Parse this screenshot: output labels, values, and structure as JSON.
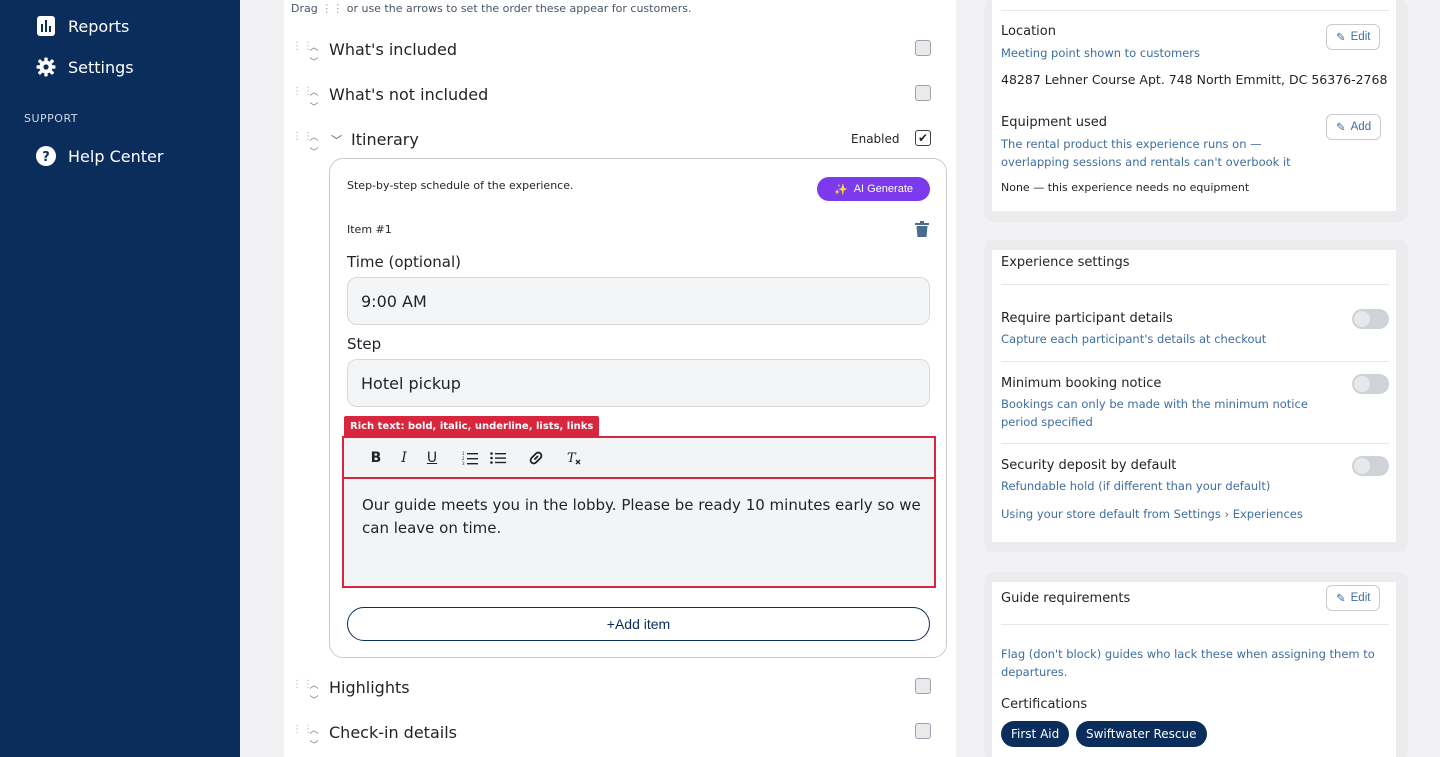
{
  "sidebar": {
    "items": [
      {
        "label": "Reports",
        "icon": "reports-icon"
      },
      {
        "label": "Settings",
        "icon": "gear-icon"
      }
    ],
    "support_heading": "SUPPORT",
    "help": {
      "label": "Help Center",
      "icon": "help-icon"
    }
  },
  "main": {
    "hint_prefix": "Drag",
    "hint_dots": "⋮⋮",
    "hint_suffix": "or use the arrows to set the order these appear for customers.",
    "sections": [
      {
        "title": "What's included",
        "checked": false
      },
      {
        "title": "What's not included",
        "checked": false
      },
      {
        "title": "Itinerary",
        "checked": true,
        "enabled_label": "Enabled"
      },
      {
        "title": "Highlights",
        "checked": false
      },
      {
        "title": "Check-in details",
        "checked": false
      }
    ],
    "itinerary": {
      "description": "Step-by-step schedule of the experience.",
      "ai_button": "AI Generate",
      "item_label": "Item #1",
      "time_label": "Time (optional)",
      "time_value": "9:00 AM",
      "step_label": "Step",
      "step_value": "Hotel pickup",
      "rich_text_tag": "Rich text: bold, italic, underline, lists, links",
      "toolbar": {
        "bold": "B",
        "italic": "I",
        "underline": "U"
      },
      "content": "Our guide meets you in the lobby. Please be ready 10 minutes early so we can leave on time.",
      "add_item": "+Add item"
    }
  },
  "right": {
    "location": {
      "title": "Location",
      "subtitle": "Meeting point shown to customers",
      "value": "48287 Lehner Course Apt. 748 North Emmitt, DC 56376-2768",
      "button": "Edit"
    },
    "equipment": {
      "title": "Equipment used",
      "subtitle": "The rental product this experience runs on — overlapping sessions and rentals can't overbook it",
      "value": "None — this experience needs no equipment",
      "button": "Add"
    },
    "experience_settings": {
      "title": "Experience settings",
      "rows": [
        {
          "title": "Require participant details",
          "subtitle": "Capture each participant's details at checkout",
          "on": false
        },
        {
          "title": "Minimum booking notice",
          "subtitle": "Bookings can only be made with the minimum notice period specified",
          "on": false
        },
        {
          "title": "Security deposit by default",
          "subtitle": "Refundable hold (if different than your default)",
          "on": false
        }
      ],
      "footer_link": "Using your store default from Settings › Experiences"
    },
    "guide_requirements": {
      "title": "Guide requirements",
      "button": "Edit",
      "subtitle": "Flag (don't block) guides who lack these when assigning them to departures.",
      "cert_label": "Certifications",
      "certs": [
        "First Aid",
        "Swiftwater Rescue"
      ]
    }
  }
}
